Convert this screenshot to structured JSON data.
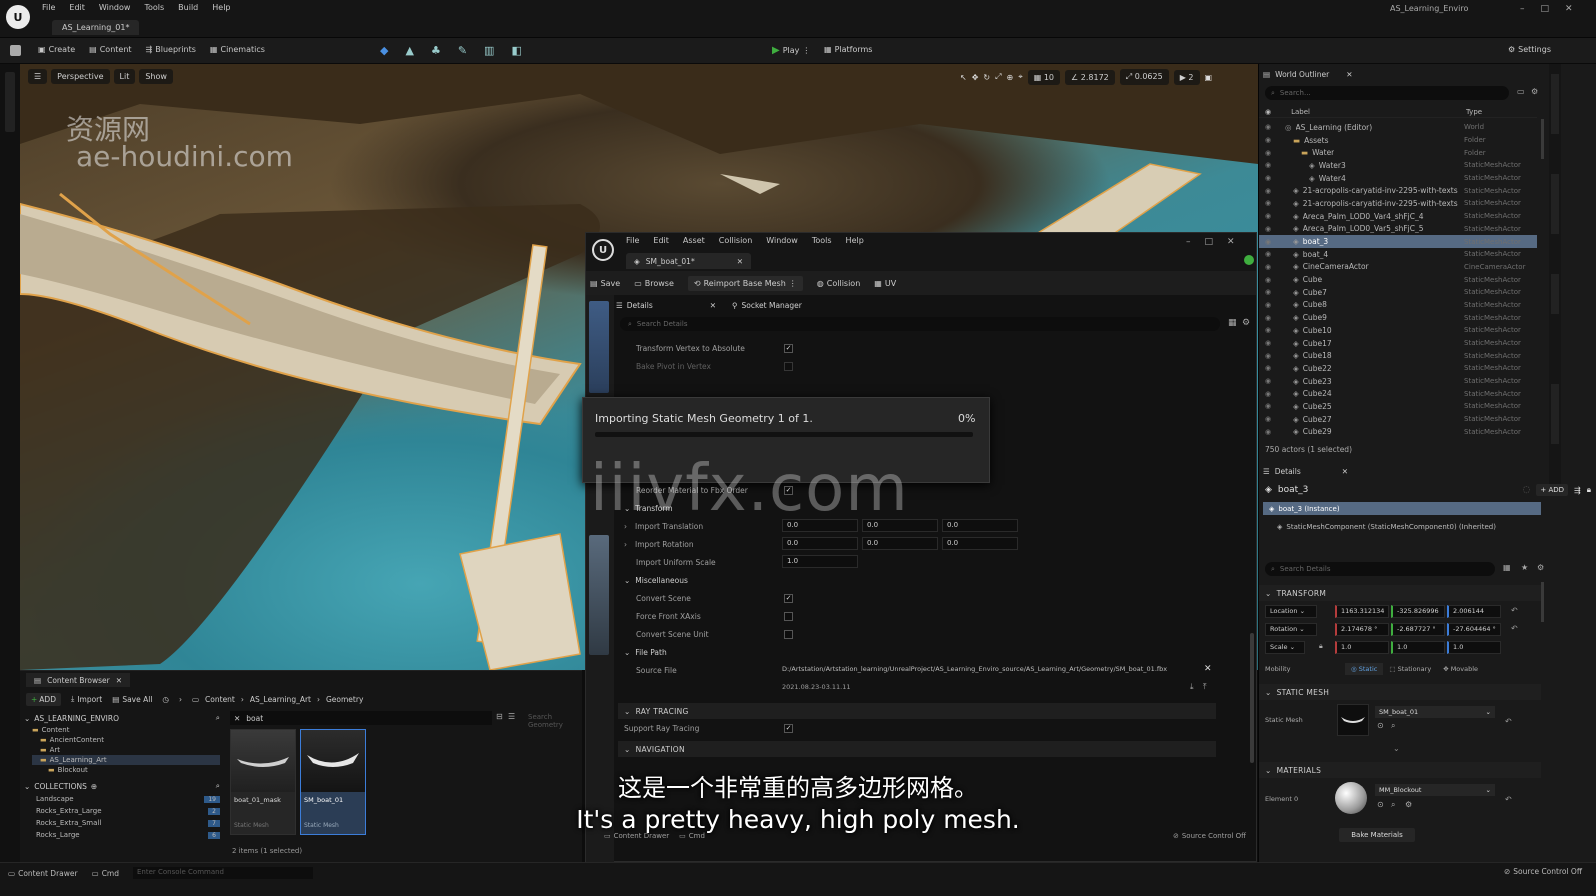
{
  "main_window": {
    "menu": [
      "File",
      "Edit",
      "Window",
      "Tools",
      "Build",
      "Help"
    ],
    "level_tab": "AS_Learning_01*",
    "title": "AS_Learning_Enviro",
    "toolbar": {
      "create": "Create",
      "content": "Content",
      "blueprints": "Blueprints",
      "cinematics": "Cinematics",
      "play": "Play",
      "platforms": "Platforms",
      "settings": "Settings"
    }
  },
  "viewport": {
    "perspective": "Perspective",
    "lit": "Lit",
    "show": "Show",
    "stats": [
      "10",
      "2.8172",
      "0.0625",
      "2"
    ]
  },
  "watermark": {
    "site_cn": "资源网",
    "site": "ae-houdini.com",
    "overlay": "iiivfx.com"
  },
  "outliner": {
    "title": "World Outliner",
    "search_placeholder": "Search...",
    "col_label": "Label",
    "col_type": "Type",
    "rows": [
      {
        "label": "AS_Learning (Editor)",
        "type": "World",
        "indent": 1
      },
      {
        "label": "Assets",
        "type": "Folder",
        "indent": 2
      },
      {
        "label": "Water",
        "type": "Folder",
        "indent": 3
      },
      {
        "label": "Water3",
        "type": "StaticMeshActor",
        "indent": 4
      },
      {
        "label": "Water4",
        "type": "StaticMeshActor",
        "indent": 4
      },
      {
        "label": "21-acropolis-caryatid-inv-2295-with-texts",
        "type": "StaticMeshActor",
        "indent": 2
      },
      {
        "label": "21-acropolis-caryatid-inv-2295-with-texts",
        "type": "StaticMeshActor",
        "indent": 2
      },
      {
        "label": "Areca_Palm_LOD0_Var4_shFjC_4",
        "type": "StaticMeshActor",
        "indent": 2
      },
      {
        "label": "Areca_Palm_LOD0_Var5_shFjC_5",
        "type": "StaticMeshActor",
        "indent": 2
      },
      {
        "label": "boat_3",
        "type": "StaticMeshActor",
        "indent": 2,
        "selected": true
      },
      {
        "label": "boat_4",
        "type": "StaticMeshActor",
        "indent": 2
      },
      {
        "label": "CineCameraActor",
        "type": "CineCameraActor",
        "indent": 2
      },
      {
        "label": "Cube",
        "type": "StaticMeshActor",
        "indent": 2
      },
      {
        "label": "Cube7",
        "type": "StaticMeshActor",
        "indent": 2
      },
      {
        "label": "Cube8",
        "type": "StaticMeshActor",
        "indent": 2
      },
      {
        "label": "Cube9",
        "type": "StaticMeshActor",
        "indent": 2
      },
      {
        "label": "Cube10",
        "type": "StaticMeshActor",
        "indent": 2
      },
      {
        "label": "Cube17",
        "type": "StaticMeshActor",
        "indent": 2
      },
      {
        "label": "Cube18",
        "type": "StaticMeshActor",
        "indent": 2
      },
      {
        "label": "Cube22",
        "type": "StaticMeshActor",
        "indent": 2
      },
      {
        "label": "Cube23",
        "type": "StaticMeshActor",
        "indent": 2
      },
      {
        "label": "Cube24",
        "type": "StaticMeshActor",
        "indent": 2
      },
      {
        "label": "Cube25",
        "type": "StaticMeshActor",
        "indent": 2
      },
      {
        "label": "Cube27",
        "type": "StaticMeshActor",
        "indent": 2
      },
      {
        "label": "Cube29",
        "type": "StaticMeshActor",
        "indent": 2
      }
    ],
    "status": "750 actors (1 selected)"
  },
  "details": {
    "title": "Details",
    "actor": "boat_3",
    "add": "+ ADD",
    "instance": "boat_3 (Instance)",
    "component": "StaticMeshComponent (StaticMeshComponent0) (Inherited)",
    "search_placeholder": "Search Details",
    "transform_header": "TRANSFORM",
    "location_label": "Location",
    "rotation_label": "Rotation",
    "scale_label": "Scale",
    "location": [
      "1163.312134",
      "-325.826996",
      "2.006144"
    ],
    "rotation": [
      "2.174678 °",
      "-2.687727 °",
      "-27.604464 °"
    ],
    "scale": [
      "1.0",
      "1.0",
      "1.0"
    ],
    "mobility_label": "Mobility",
    "mobility": [
      "Static",
      "Stationary",
      "Movable"
    ],
    "static_mesh_header": "STATIC MESH",
    "static_mesh_label": "Static Mesh",
    "static_mesh_value": "SM_boat_01",
    "materials_header": "MATERIALS",
    "element_label": "Element 0",
    "material_value": "MM_Blockout",
    "bake_button": "Bake Materials"
  },
  "mesh_editor": {
    "menu": [
      "File",
      "Edit",
      "Asset",
      "Collision",
      "Window",
      "Tools",
      "Help"
    ],
    "tab": "SM_boat_01*",
    "toolbar": {
      "save": "Save",
      "browse": "Browse",
      "reimport": "Reimport Base Mesh",
      "collision": "Collision",
      "uv": "UV"
    },
    "details_tab": "Details",
    "socket_tab": "Socket Manager",
    "search_placeholder": "Search Details",
    "props_top": [
      {
        "label": "Transform Vertex to Absolute",
        "checked": true
      },
      {
        "label": "Bake Pivot in Vertex",
        "checked": false
      }
    ],
    "props_mid": [
      {
        "label": "Reorder Material to Fbx Order",
        "checked": true
      }
    ],
    "transform_section": "Transform",
    "import_translation": "Import Translation",
    "import_rotation": "Import Rotation",
    "import_uniform_scale": "Import Uniform Scale",
    "translation": [
      "0.0",
      "0.0",
      "0.0"
    ],
    "rotation": [
      "0.0",
      "0.0",
      "0.0"
    ],
    "uniform_scale": "1.0",
    "misc_section": "Miscellaneous",
    "misc_props": [
      {
        "label": "Convert Scene",
        "checked": true
      },
      {
        "label": "Force Front XAxis",
        "checked": false
      },
      {
        "label": "Convert Scene Unit",
        "checked": false
      }
    ],
    "file_section": "File Path",
    "source_label": "Source File",
    "source_path": "D:/Artstation/Artstation_learning/UnrealProject/AS_Learning_Enviro_source/AS_Learning_Art/Geometry/SM_boat_01.fbx",
    "source_date": "2021.08.23-03.11.11",
    "ray_section": "RAY TRACING",
    "support_ray": "Support Ray Tracing",
    "nav_section": "NAVIGATION",
    "source_control": "Source Control Off",
    "content_drawer": "Content Drawer",
    "cmd": "Cmd"
  },
  "progress": {
    "title": "Importing Static Mesh Geometry 1 of 1.",
    "percent_label": "0%",
    "percent": 0
  },
  "content_browser": {
    "tab": "Content Browser",
    "add": "ADD",
    "import": "Import",
    "save_all": "Save All",
    "breadcrumb": [
      "Content",
      "AS_Learning_Art",
      "Geometry"
    ],
    "root": "AS_LEARNING_ENVIRO",
    "tree": [
      "Content",
      "AncientContent",
      "Art",
      "AS_Learning_Art",
      "Blockout"
    ],
    "collections_label": "COLLECTIONS",
    "collections": [
      {
        "name": "Landscape",
        "count": "19"
      },
      {
        "name": "Rocks_Extra_Large",
        "count": "2"
      },
      {
        "name": "Rocks_Extra_Small",
        "count": "7"
      },
      {
        "name": "Rocks_Large",
        "count": "6"
      }
    ],
    "filter": "boat",
    "search_placeholder": "Search Geometry",
    "assets": [
      {
        "name": "boat_01_mask",
        "type": "Static Mesh"
      },
      {
        "name": "SM_boat_01",
        "type": "Static Mesh"
      }
    ],
    "status": "2 items (1 selected)"
  },
  "statusbar": {
    "content_drawer": "Content Drawer",
    "cmd": "Cmd",
    "console_placeholder": "Enter Console Command",
    "source_control": "Source Control Off"
  },
  "subtitles": {
    "cn": "这是一个非常重的高多边形网格。",
    "en": "It's a pretty heavy, high poly mesh."
  },
  "colors": {
    "accent": "#3c7dd9",
    "selection": "#566a83",
    "play_green": "#3fae3f",
    "background": "#151515"
  }
}
